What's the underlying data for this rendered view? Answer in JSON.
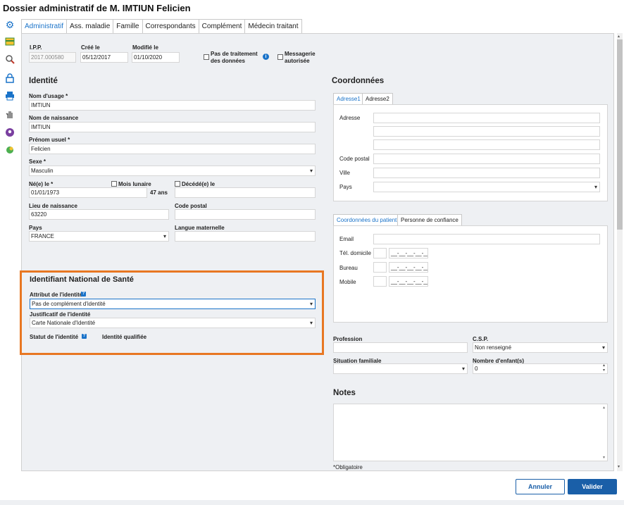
{
  "window": {
    "title": "Dossier administratif de M.  IMTIUN Felicien"
  },
  "tabs": [
    "Administratif",
    "Ass. maladie",
    "Famille",
    "Correspondants",
    "Complément",
    "Médecin traitant"
  ],
  "header_fields": {
    "ipp_label": "I.P.P.",
    "ipp_value": "2017.000580",
    "cree_label": "Créé le",
    "cree_value": "05/12/2017",
    "modifie_label": "Modifié le",
    "modifie_value": "01/10/2020",
    "pas_traitement_label": "Pas de traitement des données",
    "pas_traitement_l1": "Pas de traitement",
    "pas_traitement_l2": "des données",
    "messagerie_l1": "Messagerie",
    "messagerie_l2": "autorisée"
  },
  "identite": {
    "title": "Identité",
    "nom_usage_label": "Nom d'usage *",
    "nom_usage_value": "IMTIUN",
    "nom_naissance_label": "Nom de naissance",
    "nom_naissance_value": "IMTIUN",
    "prenom_label": "Prénom usuel *",
    "prenom_value": "Felicien",
    "sexe_label": "Sexe *",
    "sexe_value": "Masculin",
    "ne_label": "Né(e) le *",
    "ne_value": "01/01/1973",
    "age": "47 ans",
    "mois_lunaire_label": "Mois lunaire",
    "decede_label": "Décédé(e) le",
    "lieu_label": "Lieu de naissance",
    "lieu_value": "63220",
    "cp_label": "Code postal",
    "pays_label": "Pays",
    "pays_value": "FRANCE",
    "langue_label": "Langue maternelle"
  },
  "ins": {
    "title": "Identifiant National de Santé",
    "attribut_label": "Attribut de l'identité",
    "attribut_value": "Pas de complément d'identité",
    "justificatif_label": "Justificatif de l'identité",
    "justificatif_value": "Carte Nationale d'Identité",
    "statut_label": "Statut de l'identité",
    "statut_value": "Identité qualifiée"
  },
  "coordonnees": {
    "title": "Coordonnées",
    "tabs": [
      "Adresse1",
      "Adresse2"
    ],
    "adresse_label": "Adresse",
    "cp_label": "Code postal",
    "ville_label": "Ville",
    "pays_label": "Pays"
  },
  "contact": {
    "tabs": [
      "Coordonnées du patient",
      "Personne de confiance"
    ],
    "email_label": "Email",
    "tel_label": "Tél. domicile",
    "bureau_label": "Bureau",
    "mobile_label": "Mobile",
    "phone_mask": "__-__-__-__-__"
  },
  "other": {
    "profession_label": "Profession",
    "csp_label": "C.S.P.",
    "csp_value": "Non renseigné",
    "situation_label": "Situation familiale",
    "enfants_label": "Nombre d'enfant(s)",
    "enfants_value": "0"
  },
  "notes": {
    "title": "Notes",
    "obligatoire": "*Obligatoire"
  },
  "buttons": {
    "cancel": "Annuler",
    "ok": "Valider"
  },
  "icons": [
    "gear-icon",
    "card-icon",
    "search-person-icon",
    "lock-icon",
    "printer-icon",
    "hand-icon",
    "avatar-icon",
    "leaf-icon"
  ],
  "colors": {
    "accent": "#1a73c9",
    "highlight_border": "#e87722",
    "primary_button": "#1a5fa8"
  }
}
